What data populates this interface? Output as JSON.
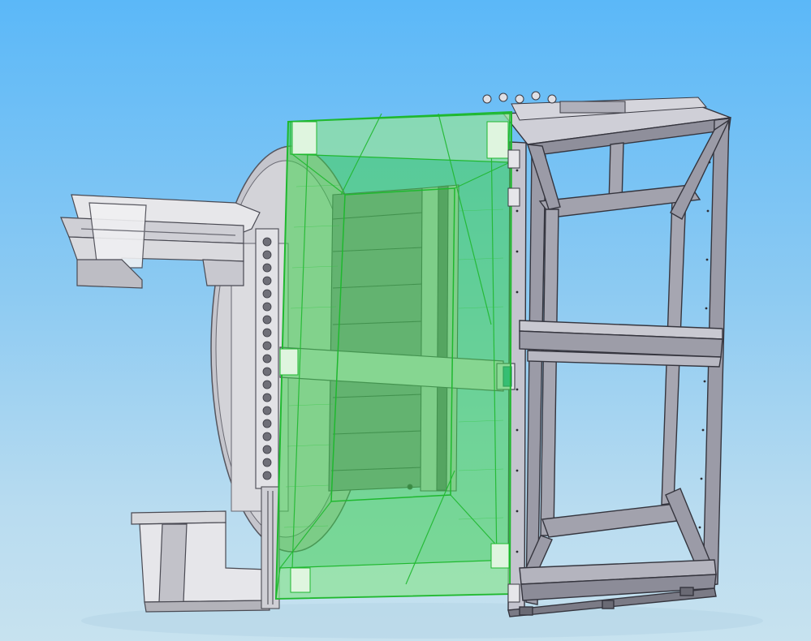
{
  "viewport": {
    "background_top": "#5bb8f8",
    "background_bottom": "#c7e2ef"
  },
  "colors": {
    "frame_face": "#9a9aa6",
    "frame_light": "#c9c9d3",
    "frame_edge": "#3a3a44",
    "machine_body": "#d9d9dd",
    "machine_shadow": "#a9a9b0",
    "panel_dark": "#8d8d98",
    "selection_fill": "#3fd24f",
    "selection_stroke": "#1fb82f",
    "accent_teal": "#2aa6a0"
  },
  "model": {
    "name": "assembly-3d-view",
    "highlighted_part": "door-panel"
  }
}
